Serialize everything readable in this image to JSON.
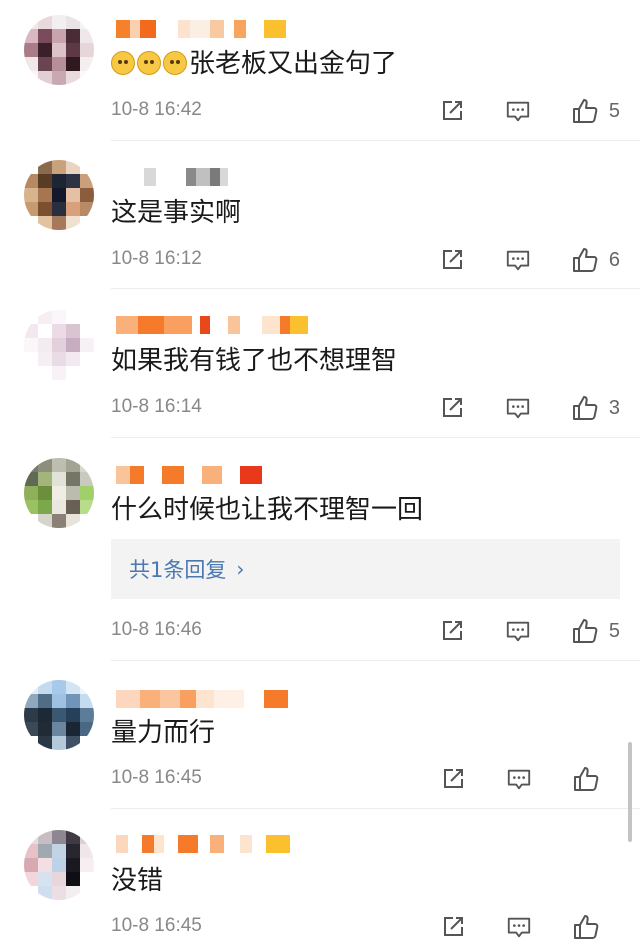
{
  "comments": [
    {
      "text": "张老板又出金句了",
      "emoji_count": 3,
      "time": "10-8 16:42",
      "likes": "5"
    },
    {
      "text": "这是事实啊",
      "time": "10-8 16:12",
      "likes": "6"
    },
    {
      "text": "如果我有钱了也不想理智",
      "time": "10-8 16:14",
      "likes": "3"
    },
    {
      "text": "什么时候也让我不理智一回",
      "time": "10-8 16:46",
      "likes": "5",
      "reply_label": "共1条回复",
      "reply_chevron": "›"
    },
    {
      "text": "量力而行",
      "time": "10-8 16:45",
      "likes": ""
    },
    {
      "text": "没错",
      "time": "10-8 16:45",
      "likes": ""
    }
  ],
  "icons": {
    "share": "share-icon",
    "comment": "comment-icon",
    "like": "like-icon"
  },
  "colors": {
    "link": "#4a78b0",
    "time": "#888888",
    "icon": "#555555"
  }
}
